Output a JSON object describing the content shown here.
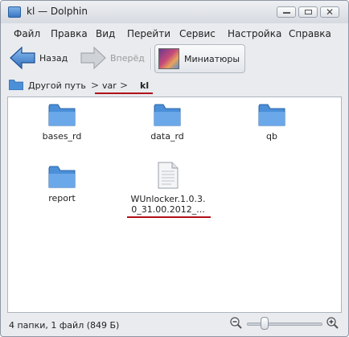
{
  "window": {
    "title": "kl — Dolphin"
  },
  "menu": [
    {
      "label": "Файл"
    },
    {
      "label": "Правка"
    },
    {
      "label": "Вид"
    },
    {
      "label": "Перейти"
    },
    {
      "label": "Сервис"
    },
    {
      "label": "Настройка"
    },
    {
      "label": "Справка"
    }
  ],
  "toolbar": {
    "back_label": "Назад",
    "forward_label": "Вперёд",
    "view_label": "Миниатюры"
  },
  "breadcrumb": {
    "root": "Другой путь",
    "sep": ">",
    "segment1": "var",
    "current": "kl"
  },
  "files": [
    {
      "name": "bases_rd",
      "kind": "folder"
    },
    {
      "name": "data_rd",
      "kind": "folder"
    },
    {
      "name": "qb",
      "kind": "folder"
    },
    {
      "name": "report",
      "kind": "folder"
    },
    {
      "name_line1": "WUnlocker.1.0.3.",
      "name_line2": "0_31.00.2012_...",
      "kind": "file"
    }
  ],
  "status": {
    "text": "4 папки, 1 файл (849 Б)"
  },
  "zoom": {
    "level_fraction": 0.2
  },
  "colors": {
    "annotation": "#b0101a",
    "folder": "#4a8fd8"
  }
}
